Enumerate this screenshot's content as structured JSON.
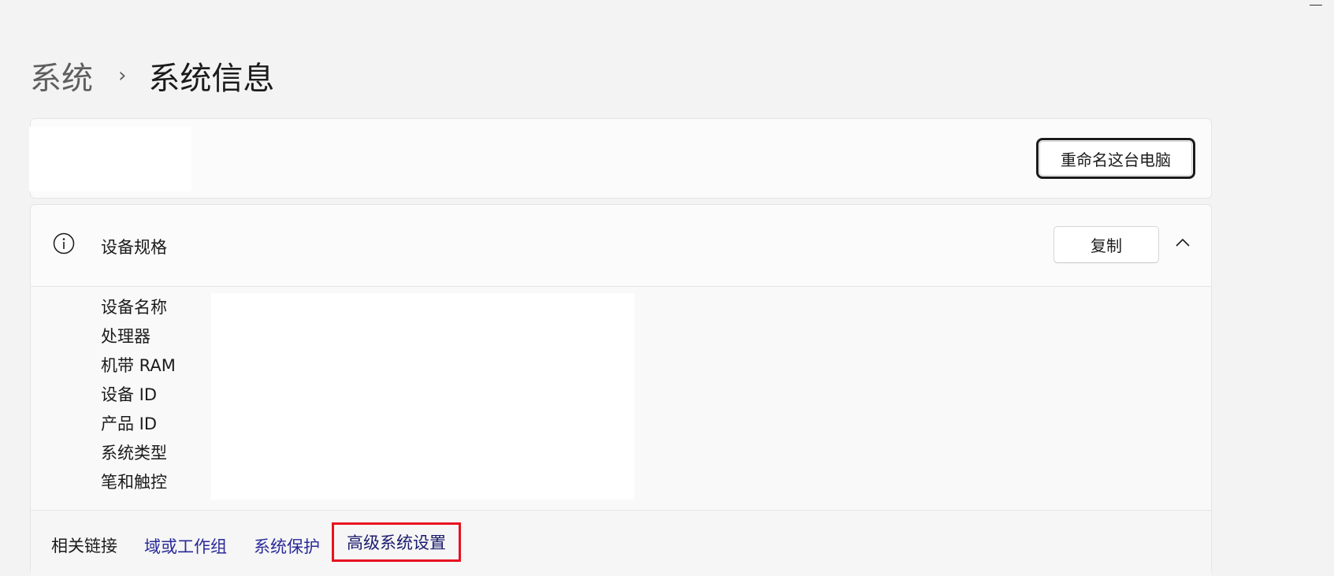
{
  "window": {
    "minimize_icon": "minimize-icon"
  },
  "breadcrumb": {
    "parent": "系统",
    "separator": "›",
    "current": "系统信息"
  },
  "pc_card": {
    "rename_button": "重命名这台电脑"
  },
  "specs": {
    "icon": "info-icon",
    "title": "设备规格",
    "copy_button": "复制",
    "collapse_icon": "chevron-up-icon",
    "rows": [
      {
        "label": "设备名称"
      },
      {
        "label": "处理器"
      },
      {
        "label": "机带 RAM"
      },
      {
        "label": "设备 ID"
      },
      {
        "label": "产品 ID"
      },
      {
        "label": "系统类型"
      },
      {
        "label": "笔和触控"
      }
    ]
  },
  "related_links": {
    "title": "相关链接",
    "links": [
      {
        "label": "域或工作组"
      },
      {
        "label": "系统保护"
      },
      {
        "label": "高级系统设置"
      }
    ],
    "highlight_color": "#e8121e",
    "link_color": "#2a2a9a"
  }
}
